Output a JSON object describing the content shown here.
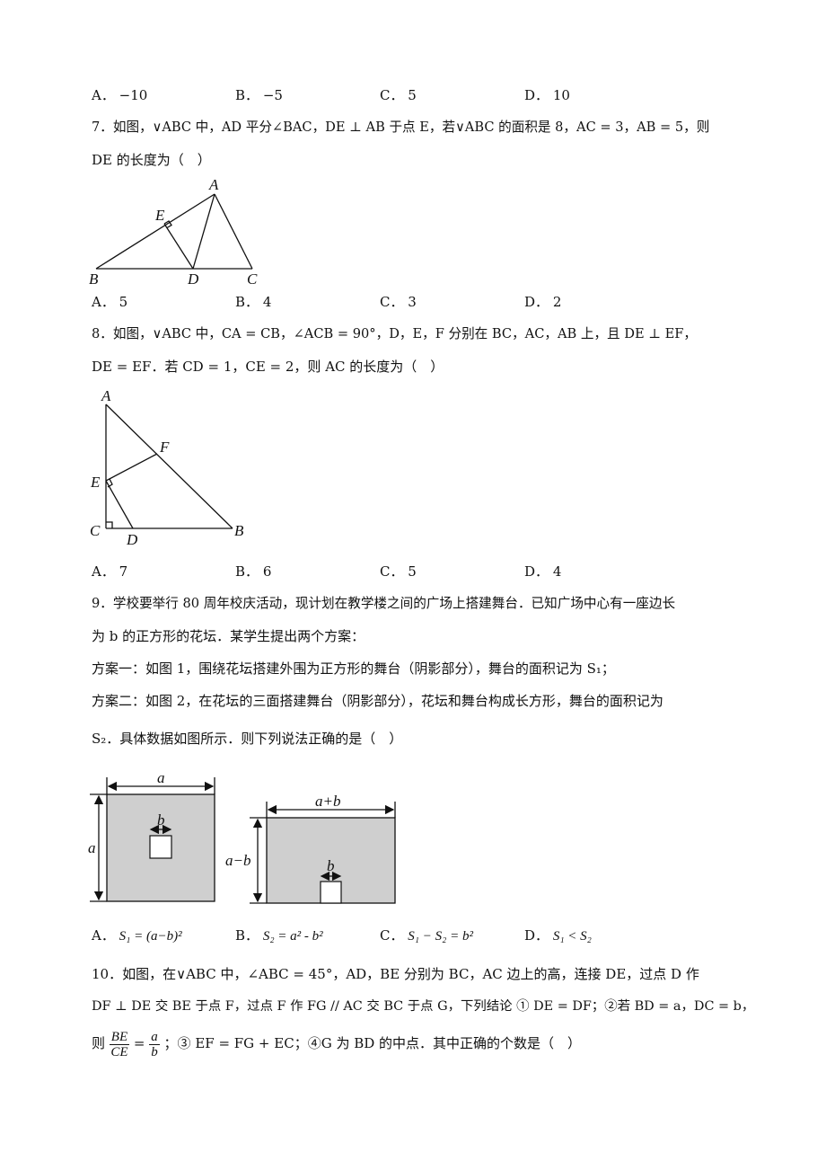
{
  "q6": {
    "options": [
      {
        "letter": "A．",
        "value": "−10"
      },
      {
        "letter": "B．",
        "value": "−5"
      },
      {
        "letter": "C．",
        "value": "5"
      },
      {
        "letter": "D．",
        "value": "10"
      }
    ]
  },
  "q7": {
    "line1": "7．如图，∨ABC 中，AD 平分∠BAC，DE ⊥ AB 于点 E，若∨ABC 的面积是 8，AC = 3，AB = 5，则",
    "line2": "DE 的长度为（　）",
    "figure_labels": {
      "A": "A",
      "B": "B",
      "C": "C",
      "D": "D",
      "E": "E"
    },
    "options": [
      {
        "letter": "A．",
        "value": "5"
      },
      {
        "letter": "B．",
        "value": "4"
      },
      {
        "letter": "C．",
        "value": "3"
      },
      {
        "letter": "D．",
        "value": "2"
      }
    ]
  },
  "q8": {
    "line1": "8．如图，∨ABC 中，CA = CB，∠ACB = 90°，D，E，F 分别在 BC，AC，AB 上，且 DE ⊥ EF，",
    "line2": "DE = EF．若 CD = 1，CE = 2，则 AC 的长度为（　）",
    "figure_labels": {
      "A": "A",
      "B": "B",
      "C": "C",
      "D": "D",
      "E": "E",
      "F": "F"
    },
    "options": [
      {
        "letter": "A．",
        "value": "7"
      },
      {
        "letter": "B．",
        "value": "6"
      },
      {
        "letter": "C．",
        "value": "5"
      },
      {
        "letter": "D．",
        "value": "4"
      }
    ]
  },
  "q9": {
    "line1": "9．学校要举行 80 周年校庆活动，现计划在教学楼之间的广场上搭建舞台．已知广场中心有一座边长",
    "line2": "为 b 的正方形的花坛．某学生提出两个方案：",
    "line3": "方案一：如图 1，围绕花坛搭建外围为正方形的舞台（阴影部分），舞台的面积记为 S₁；",
    "line4": "方案二：如图 2，在花坛的三面搭建舞台（阴影部分），花坛和舞台构成长方形，舞台的面积记为",
    "line5": "S₂．具体数据如图所示．则下列说法正确的是（　）",
    "figure1_labels": {
      "width": "a",
      "height": "a",
      "inner": "b"
    },
    "figure2_labels": {
      "width": "a+b",
      "height": "a−b",
      "inner": "b"
    },
    "options": [
      {
        "letter": "A．",
        "value": "S₁ = (a−b)²"
      },
      {
        "letter": "B．",
        "value": "S₂ = a² - b²"
      },
      {
        "letter": "C．",
        "value": "S₁ − S₂ = b²"
      },
      {
        "letter": "D．",
        "value": "S₁ < S₂"
      }
    ]
  },
  "q10": {
    "line1": "10．如图，在∨ABC 中，∠ABC = 45°，AD，BE 分别为 BC，AC 边上的高，连接 DE，过点 D 作",
    "line2": "DF ⊥ DE 交 BE 于点 F，过点 F 作 FG // AC 交 BC 于点 G，下列结论 ① DE = DF；②若 BD = a，DC = b，",
    "line3_prefix": "则",
    "frac1_num": "BE",
    "frac1_den": "CE",
    "eq": "=",
    "frac2_num": "a",
    "frac2_den": "b",
    "line3_suffix": "；③ EF = FG + EC；④G 为 BD 的中点．其中正确的个数是（　）"
  }
}
